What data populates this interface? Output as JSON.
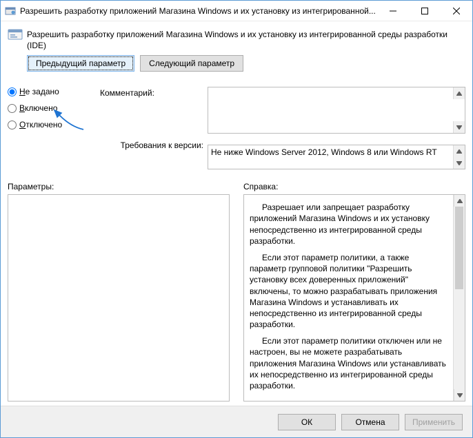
{
  "titlebar": {
    "text": "Разрешить разработку приложений Магазина Windows и их установку из интегрированной..."
  },
  "header": {
    "policy_title": "Разрешить разработку приложений Магазина Windows и их установку из интегрированной среды разработки (IDE)"
  },
  "nav": {
    "prev": "Предыдущий параметр",
    "next": "Следующий параметр"
  },
  "state": {
    "not_configured_prefix": "Н",
    "not_configured_rest": "е задано",
    "enabled_prefix": "В",
    "enabled_rest": "ключено",
    "disabled_prefix": "О",
    "disabled_rest": "тключено",
    "selected": "not_configured"
  },
  "labels": {
    "comment": "Комментарий:",
    "requirements": "Требования к версии:",
    "parameters": "Параметры:",
    "help": "Справка:"
  },
  "fields": {
    "comment_value": "",
    "requirements_value": "Не ниже Windows Server 2012, Windows 8 или Windows RT"
  },
  "help": {
    "p1": "Разрешает или запрещает разработку приложений Магазина Windows и их установку непосредственно из интегрированной среды разработки.",
    "p2": "Если этот параметр политики, а также параметр групповой политики \"Разрешить установку всех доверенных приложений\" включены, то можно разрабатывать приложения Магазина Windows и устанавливать их непосредственно из интегрированной среды разработки.",
    "p3": "Если этот параметр политики отключен или не настроен, вы не можете разрабатывать приложения Магазина Windows или устанавливать их непосредственно из интегрированной среды разработки."
  },
  "footer": {
    "ok": "ОК",
    "cancel": "Отмена",
    "apply": "Применить"
  }
}
